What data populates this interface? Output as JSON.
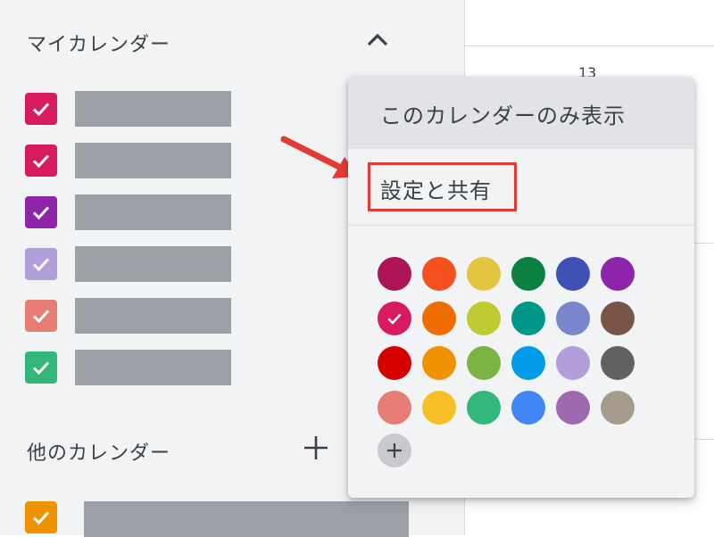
{
  "sidebar": {
    "my_calendars_title": "マイカレンダー",
    "my_calendars": [
      {
        "color": "#d81b60"
      },
      {
        "color": "#d81b60"
      },
      {
        "color": "#8e24aa"
      },
      {
        "color": "#b39ddb"
      },
      {
        "color": "#e67c73"
      },
      {
        "color": "#33b679"
      }
    ],
    "other_calendars_title": "他のカレンダー",
    "other_calendars": [
      {
        "color": "#f09300"
      }
    ],
    "icons": {
      "collapse": "chevron-up-icon",
      "add": "plus-icon",
      "check": "check-icon"
    }
  },
  "main": {
    "date_number": "13"
  },
  "popup": {
    "items": [
      {
        "label": "このカレンダーのみ表示"
      },
      {
        "label": "設定と共有"
      }
    ],
    "colors": [
      [
        "#ad1457",
        "#f4511e",
        "#e4c441",
        "#0b8043",
        "#3f51b5",
        "#8e24aa"
      ],
      [
        "#d81b60",
        "#ef6c00",
        "#c0ca33",
        "#009688",
        "#7986cb",
        "#795548"
      ],
      [
        "#d50000",
        "#f09300",
        "#7cb342",
        "#039be5",
        "#b39ddb",
        "#616161"
      ],
      [
        "#e67c73",
        "#f6bf26",
        "#33b679",
        "#4285f4",
        "#9e69af",
        "#a79b8e"
      ]
    ],
    "selected_color": "#d81b60",
    "add_color_icon": "plus-icon"
  },
  "annotation": {
    "arrow_color": "#e53935",
    "highlight_color": "#e53935"
  }
}
